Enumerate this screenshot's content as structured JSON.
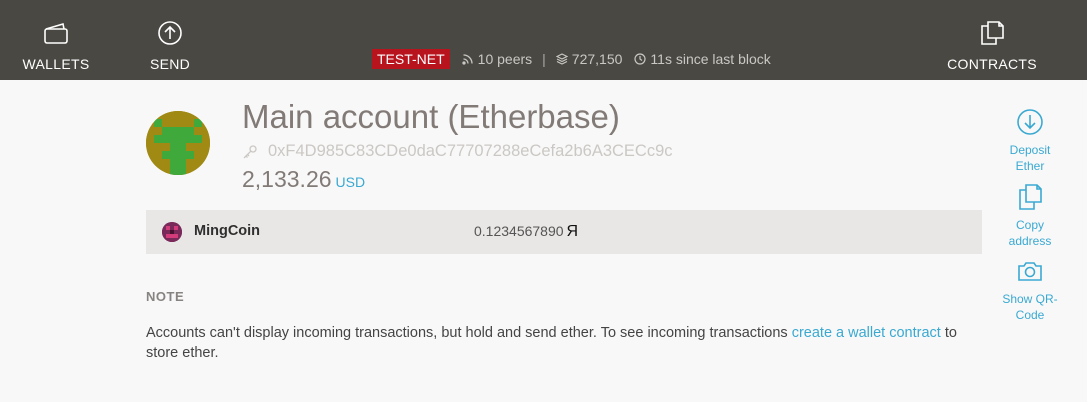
{
  "header": {
    "nav": {
      "wallets_label": "WALLETS",
      "send_label": "SEND",
      "contracts_label": "CONTRACTS"
    },
    "status": {
      "network_badge": "TEST-NET",
      "peers": "10 peers",
      "separator": "|",
      "block_number": "727,150",
      "since_last_block": "11s since last block"
    }
  },
  "account": {
    "title": "Main account (Etherbase)",
    "address": "0xF4D985C83CDe0daC77707288eCefa2b6A3CECc9c",
    "balance": "2,133.26",
    "currency": "USD"
  },
  "tokens": [
    {
      "name": "MingCoin",
      "balance": "0.1234567890",
      "symbol": "Я"
    }
  ],
  "note": {
    "heading": "NOTE",
    "text_before": "Accounts can't display incoming transactions, but hold and send ether. To see incoming transactions ",
    "link": "create a wallet contract",
    "text_after": " to store ether."
  },
  "actions": {
    "deposit_line1": "Deposit",
    "deposit_line2": "Ether",
    "copy_line1": "Copy",
    "copy_line2": "address",
    "qr_line1": "Show QR-",
    "qr_line2": "Code"
  },
  "colors": {
    "header_bg": "#4a4843",
    "accent": "#3aa9d2",
    "testnet_badge": "#b8141e"
  },
  "icons": {
    "wallets": "wallet-icon",
    "send": "arrow-up-circle-icon",
    "contracts": "documents-icon",
    "peers": "signal-icon",
    "blocks": "layers-icon",
    "time": "clock-icon",
    "address": "key-icon",
    "deposit": "arrow-down-circle-icon",
    "copy": "copy-icon",
    "qr": "camera-icon"
  }
}
